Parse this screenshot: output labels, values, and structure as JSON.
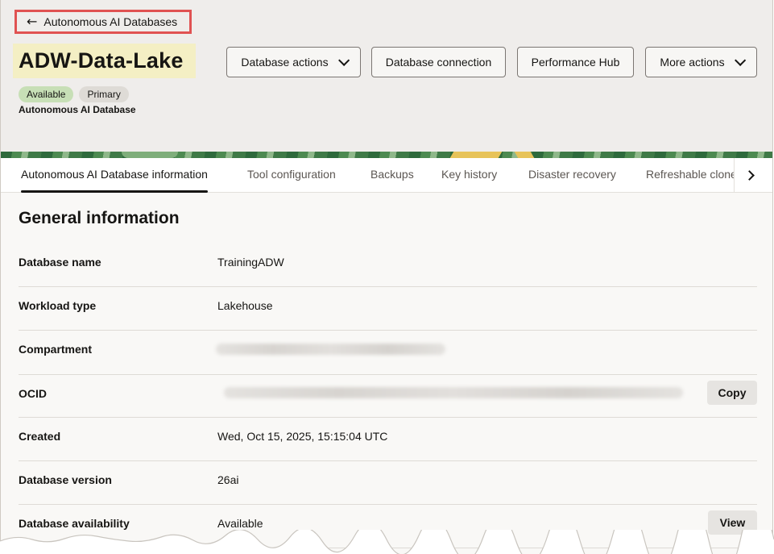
{
  "header": {
    "back_link": "Autonomous AI Databases",
    "title": "ADW-Data-Lake",
    "badges": {
      "available": "Available",
      "primary": "Primary"
    },
    "subtitle": "Autonomous AI Database",
    "buttons": {
      "database_actions": "Database actions",
      "database_connection": "Database connection",
      "performance_hub": "Performance Hub",
      "more_actions": "More actions"
    }
  },
  "tabs": [
    {
      "label": "Autonomous AI Database information",
      "active": true
    },
    {
      "label": "Tool configuration"
    },
    {
      "label": "Backups"
    },
    {
      "label": "Key history"
    },
    {
      "label": "Disaster recovery"
    },
    {
      "label": "Refreshable clones"
    }
  ],
  "general": {
    "title": "General information",
    "rows": [
      {
        "label": "Database name",
        "value": "TrainingADW"
      },
      {
        "label": "Workload type",
        "value": "Lakehouse"
      },
      {
        "label": "Compartment",
        "value": ""
      },
      {
        "label": "OCID",
        "value": "",
        "action": "Copy"
      },
      {
        "label": "Created",
        "value": "Wed, Oct 15, 2025, 15:15:04 UTC"
      },
      {
        "label": "Database version",
        "value": "26ai"
      },
      {
        "label": "Database availability",
        "value": "Available",
        "action": "View"
      }
    ]
  },
  "colors": {
    "highlight_border": "#e05252",
    "title_highlight": "#f4efc4",
    "available_badge": "#c7dfb6",
    "active_tab_underline": "#161513"
  },
  "icons": {
    "back": "arrow-left-icon",
    "dropdown": "chevron-down-icon",
    "tab_scroll": "chevron-right-icon"
  }
}
